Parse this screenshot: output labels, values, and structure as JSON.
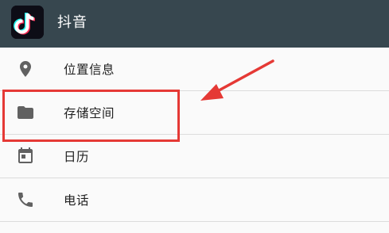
{
  "app": {
    "title": "抖音",
    "icon": "tiktok-logo"
  },
  "permissions": [
    {
      "label": "位置信息",
      "icon": "location-pin-icon"
    },
    {
      "label": "存储空间",
      "icon": "folder-icon"
    },
    {
      "label": "日历",
      "icon": "calendar-icon"
    },
    {
      "label": "电话",
      "icon": "phone-icon"
    }
  ],
  "annotation": {
    "highlighted_item": "存储空间",
    "color": "#e53935"
  },
  "colors": {
    "appbar": "#37474f",
    "icon_gray": "#616161"
  }
}
